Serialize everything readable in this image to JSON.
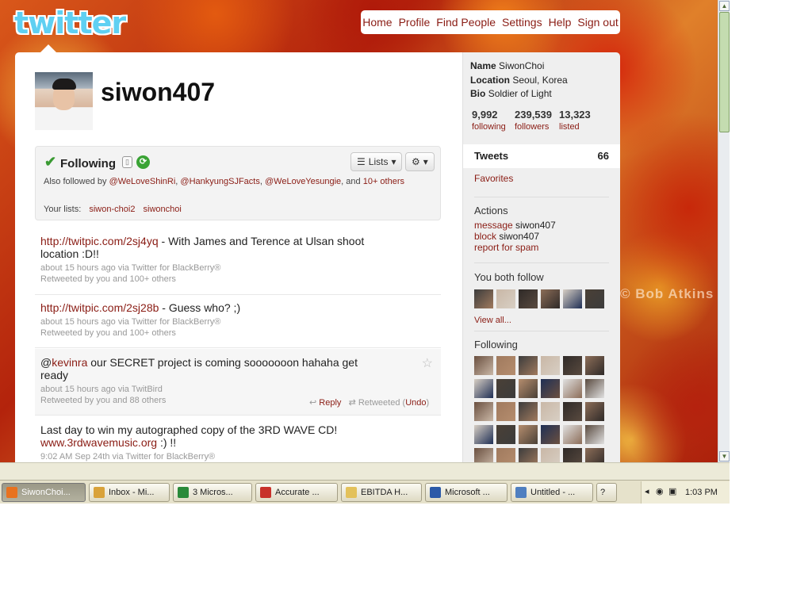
{
  "site": {
    "logo": "twitter"
  },
  "nav": [
    "Home",
    "Profile",
    "Find People",
    "Settings",
    "Help",
    "Sign out"
  ],
  "profile": {
    "username": "siwon407",
    "following_label": "Following",
    "lists_button": "Lists",
    "also_followed_prefix": "Also followed by",
    "also_followed_users": [
      "@WeLoveShinRi",
      "@HankyungSJFacts",
      "@WeLoveYesungie"
    ],
    "also_followed_and": ", and",
    "also_followed_more": "10+ others",
    "your_lists_label": "Your lists:",
    "your_lists": [
      "siwon-choi2",
      "siwonchoi"
    ]
  },
  "tweets": [
    {
      "link": "http://twitpic.com/2sj4yq",
      "text": " - With James and Terence at Ulsan shoot location :D!!",
      "meta": "about 15 hours ago via Twitter for BlackBerry®",
      "retweet": "Retweeted by you and 100+ others"
    },
    {
      "link": "http://twitpic.com/2sj28b",
      "text": " - Guess who? ;)",
      "meta": "about 15 hours ago via Twitter for BlackBerry®",
      "retweet": "Retweeted by you and 100+ others"
    },
    {
      "prefix": "@",
      "mention": "kevinra",
      "text": " our SECRET project is coming sooooooon hahaha get ready",
      "meta": "about 15 hours ago via TwitBird",
      "retweet": "Retweeted by you and 88 others",
      "reply": "Reply",
      "retweeted": "Retweeted",
      "undo": "Undo"
    },
    {
      "text": "Last day to win my autographed copy of the 3RD WAVE CD! ",
      "link": "www.3rdwavemusic.org",
      "suffix": " :) !!",
      "meta": "9:02 AM Sep 24th via Twitter for BlackBerry®"
    }
  ],
  "sidebar": {
    "name_label": "Name",
    "name": "SiwonChoi",
    "location_label": "Location",
    "location": "Seoul, Korea",
    "bio_label": "Bio",
    "bio": "Soldier of Light",
    "stats": [
      {
        "count": "9,992",
        "label": "following"
      },
      {
        "count": "239,539",
        "label": "followers"
      },
      {
        "count": "13,323",
        "label": "listed"
      }
    ],
    "tweets_label": "Tweets",
    "tweets_count": "66",
    "favorites": "Favorites",
    "actions_title": "Actions",
    "message_link": "message",
    "message_user": " siwon407",
    "block_link": "block",
    "block_user": " siwon407",
    "report_link": "report for spam",
    "both_follow_title": "You both follow",
    "view_all": "View all...",
    "following_title": "Following"
  },
  "watermark": "© Bob Atkins",
  "taskbar": [
    {
      "label": "SiwonChoi...",
      "active": true,
      "color": "#e8721f"
    },
    {
      "label": "Inbox - Mi...",
      "color": "#d9a23a"
    },
    {
      "label": "3 Micros...",
      "color": "#2a8a3a"
    },
    {
      "label": "Accurate ...",
      "color": "#c8312a"
    },
    {
      "label": "EBITDA H...",
      "color": "#e3c15a"
    },
    {
      "label": "Microsoft ...",
      "color": "#2c5aa8"
    },
    {
      "label": "Untitled - ...",
      "color": "#4f7fc0"
    }
  ],
  "clock": "1:03 PM",
  "colors": {
    "link": "#8a1c14",
    "accent": "#5fd0f2",
    "check": "#3a9a32"
  }
}
